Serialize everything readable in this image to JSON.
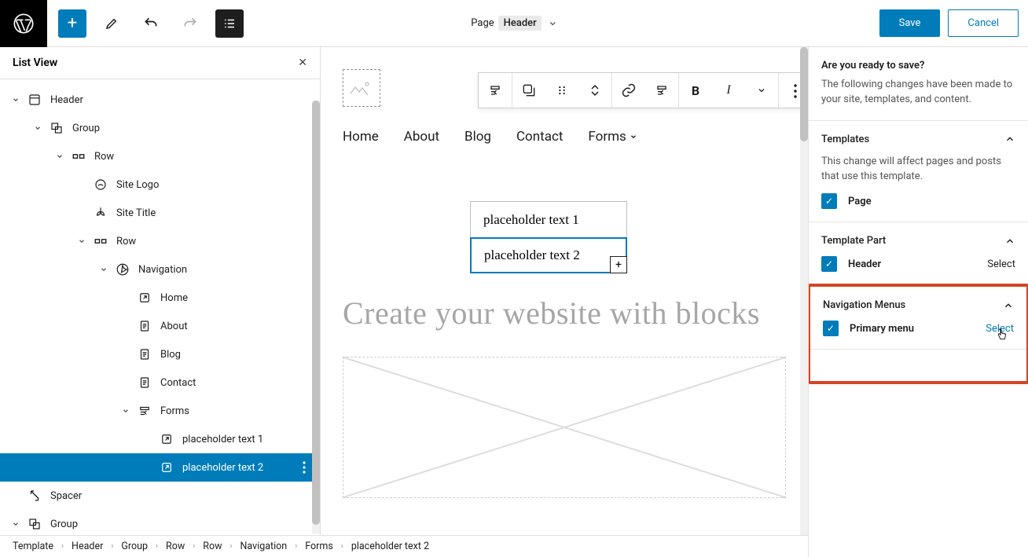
{
  "topbar": {
    "doc_label": "Page",
    "doc_tag": "Header",
    "save": "Save",
    "cancel": "Cancel"
  },
  "listview": {
    "title": "List View",
    "items": [
      {
        "depth": 0,
        "twist": true,
        "icon": "template",
        "label": "Header"
      },
      {
        "depth": 1,
        "twist": true,
        "icon": "group",
        "label": "Group"
      },
      {
        "depth": 2,
        "twist": true,
        "icon": "row",
        "label": "Row"
      },
      {
        "depth": 3,
        "twist": false,
        "icon": "sitelogo",
        "label": "Site Logo"
      },
      {
        "depth": 3,
        "twist": false,
        "icon": "sitetitle",
        "label": "Site Title"
      },
      {
        "depth": 3,
        "twist": true,
        "icon": "row",
        "label": "Row"
      },
      {
        "depth": 4,
        "twist": true,
        "icon": "nav",
        "label": "Navigation"
      },
      {
        "depth": 5,
        "twist": false,
        "icon": "linkout",
        "label": "Home"
      },
      {
        "depth": 5,
        "twist": false,
        "icon": "page",
        "label": "About"
      },
      {
        "depth": 5,
        "twist": false,
        "icon": "page",
        "label": "Blog"
      },
      {
        "depth": 5,
        "twist": false,
        "icon": "page",
        "label": "Contact"
      },
      {
        "depth": 5,
        "twist": true,
        "icon": "submenu",
        "label": "Forms"
      },
      {
        "depth": 6,
        "twist": false,
        "icon": "linkout",
        "label": "placeholder text 1"
      },
      {
        "depth": 6,
        "twist": false,
        "icon": "linkout",
        "label": "placeholder text 2",
        "selected": true
      },
      {
        "depth": 0,
        "twist": false,
        "icon": "spacer",
        "label": "Spacer"
      },
      {
        "depth": 0,
        "twist": true,
        "icon": "group",
        "label": "Group"
      }
    ]
  },
  "canvas": {
    "nav_items": [
      "Home",
      "About",
      "Blog",
      "Contact",
      "Forms"
    ],
    "subitem1": "placeholder text 1",
    "subitem2": "placeholder text 2",
    "title": "Create your website with blocks"
  },
  "rightpanel": {
    "save_prompt_h": "Are you ready to save?",
    "save_prompt_p": "The following changes have been made to your site, templates, and content.",
    "templates_h": "Templates",
    "templates_p": "This change will affect pages and posts that use this template.",
    "page_cb": "Page",
    "tpart_h": "Template Part",
    "header_cb": "Header",
    "header_sel": "Select",
    "navmenus_h": "Navigation Menus",
    "primary_cb": "Primary menu",
    "primary_sel": "Select"
  },
  "breadcrumb": [
    "Template",
    "Header",
    "Group",
    "Row",
    "Row",
    "Navigation",
    "Forms",
    "placeholder text 2"
  ]
}
